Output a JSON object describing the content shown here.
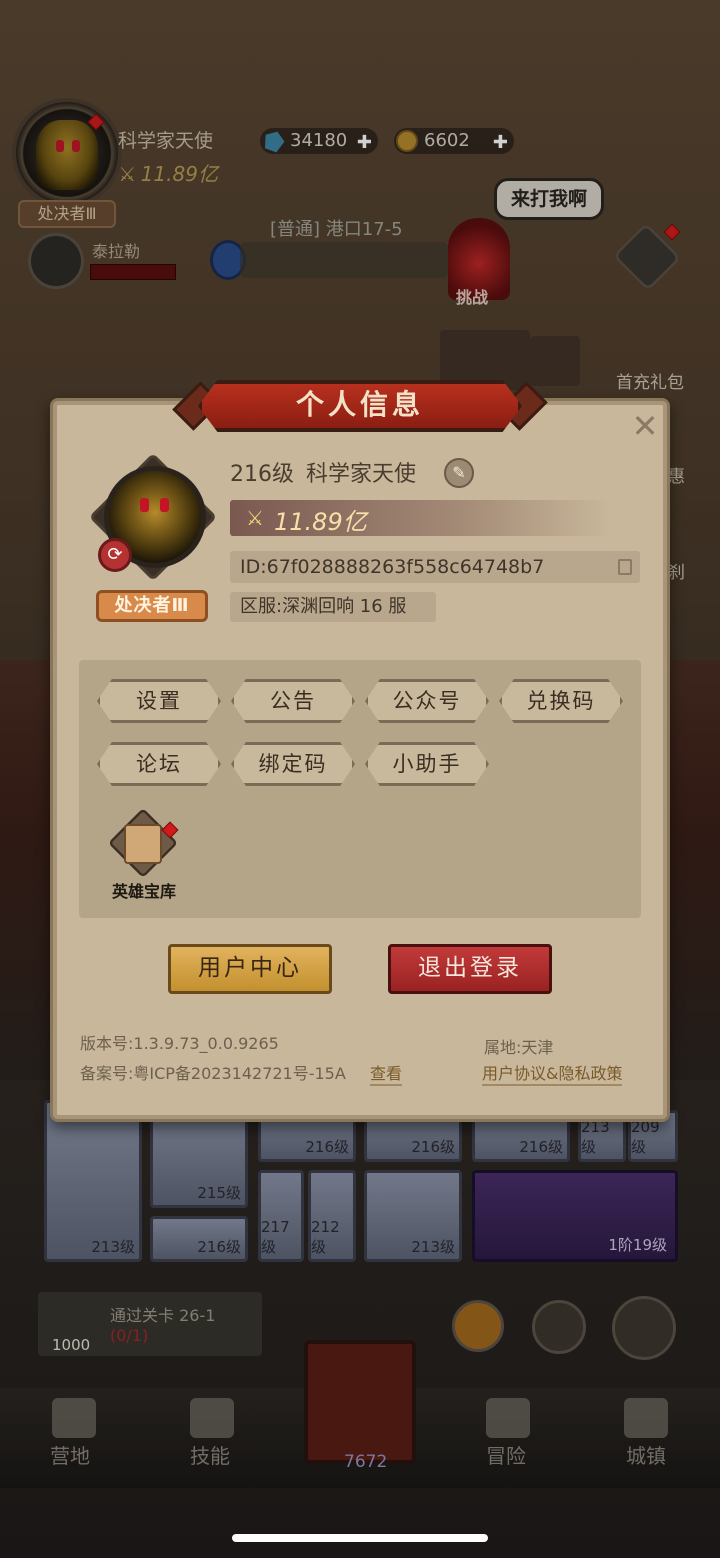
{
  "hud": {
    "player_name": "科学家天使",
    "power": "11.89亿",
    "rank": "处决者Ⅲ",
    "gems": "34180",
    "coins": "6602",
    "enemy_name": "泰拉勒",
    "stage": "[普通] 港口17-5",
    "boss_label": "挑战",
    "speech": "来打我啊",
    "side_labels": [
      "首充礼包",
      "惠",
      "刹"
    ]
  },
  "dialog": {
    "title": "个人信息",
    "level": "216级",
    "name": "科学家天使",
    "power": "11.89亿",
    "id_label": "ID:67f028888263f558c64748b7",
    "server": "区服:深渊回响 16 服",
    "rank_badge": "处决者Ⅲ",
    "buttons": [
      "设置",
      "公告",
      "公众号",
      "兑换码",
      "论坛",
      "绑定码",
      "小助手"
    ],
    "vault_label": "英雄宝库",
    "user_center": "用户中心",
    "logout": "退出登录",
    "version": "版本号:1.3.9.73_0.0.9265",
    "icp": "备案号:粤ICP备2023142721号-15A",
    "icp_view": "查看",
    "region": "属地:天津",
    "policy": "用户协议&隐私政策"
  },
  "game": {
    "card_levels": [
      "216级",
      "216级",
      "216级",
      "213级",
      "209级",
      "215级",
      "213级",
      "216级",
      "217级",
      "212级",
      "213级"
    ],
    "wing_label": "1阶19级",
    "quest_text": "通过关卡 26-1",
    "quest_progress": "(0/1)",
    "quest_reward": "1000",
    "center_value": "7672"
  },
  "tabs": [
    "营地",
    "技能",
    "冒险",
    "城镇"
  ],
  "colors": {
    "dialog_bg": "#c8b79a",
    "title_red": "#b8301e",
    "gold_button": "#e2b35e",
    "red_button": "#c23a3a"
  }
}
